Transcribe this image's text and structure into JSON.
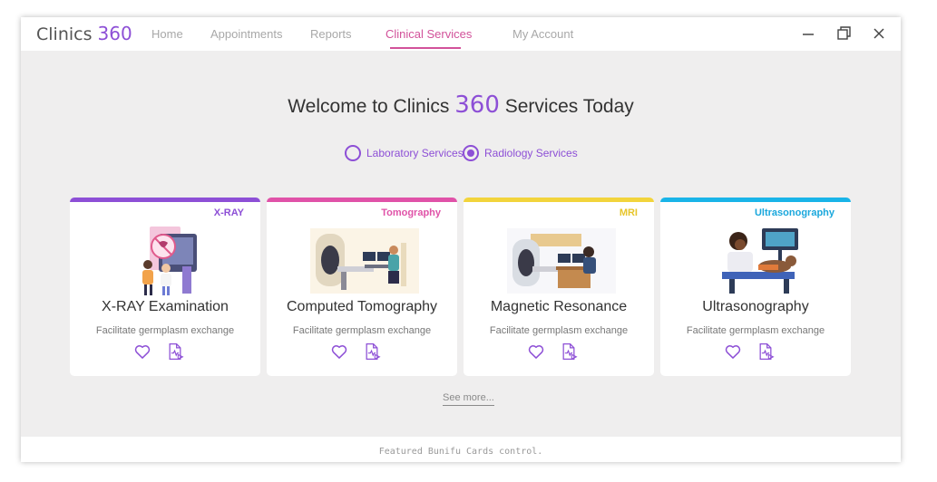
{
  "app": {
    "brand_name": "Clinics",
    "brand_number": "360"
  },
  "nav": [
    {
      "label": "Home",
      "active": false
    },
    {
      "label": "Appointments",
      "active": false
    },
    {
      "label": "Reports",
      "active": false
    },
    {
      "label": "Clinical Services",
      "active": true
    },
    {
      "label": "My Account",
      "active": false
    }
  ],
  "window_controls": {
    "minimize": "minimize-icon",
    "maximize": "maximize-icon",
    "close": "close-icon"
  },
  "main": {
    "heading_pre": "Welcome to Clinics",
    "heading_num": "360",
    "heading_post": "Services Today",
    "radios": [
      {
        "label": "Laboratory Services",
        "selected": false
      },
      {
        "label": "Radiology Services",
        "selected": true
      }
    ],
    "cards": [
      {
        "tag": "X-RAY",
        "title": "X-RAY Examination",
        "description": "Facilitate germplasm exchange",
        "accent": "#8d4fd6"
      },
      {
        "tag": "Tomography",
        "title": "Computed Tomography",
        "description": "Facilitate germplasm exchange",
        "accent": "#e052a8"
      },
      {
        "tag": "MRI",
        "title": "Magnetic Resonance",
        "description": "Facilitate germplasm exchange",
        "accent": "#f2d43c"
      },
      {
        "tag": "Ultrasonography",
        "title": "Ultrasonography",
        "description": "Facilitate germplasm exchange",
        "accent": "#19b4e8"
      }
    ],
    "see_more": "See more..."
  },
  "footer": {
    "text": "Featured Bunifu Cards control."
  },
  "colors": {
    "accent": "#8d4fd6",
    "nav_active": "#d2529a",
    "background": "#efeeee"
  }
}
